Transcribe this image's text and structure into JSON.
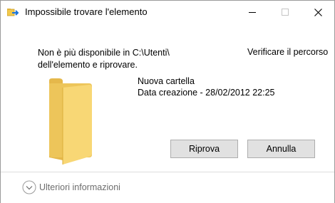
{
  "window": {
    "title": "Impossibile trovare l'elemento",
    "controls": {
      "minimize": "minimize-icon",
      "maximize": "maximize-icon",
      "close": "close-icon"
    }
  },
  "message": {
    "line1": "Non è più disponibile in C:\\Utenti\\",
    "line2": "dell'elemento e riprovare.",
    "verify_link": "Verificare il percorso"
  },
  "item": {
    "name": "Nuova cartella",
    "created": "Data creazione - 28/02/2012 22:25",
    "icon": "folder-icon"
  },
  "buttons": {
    "retry": "Riprova",
    "cancel": "Annulla"
  },
  "footer": {
    "more_info": "Ulteriori informazioni",
    "icon": "chevron-down-icon"
  },
  "colors": {
    "folder_front": "#f8d775",
    "folder_back": "#e5b84b",
    "button_bg": "#e1e1e1",
    "button_border": "#adadad",
    "footer_text": "#6d6d6d"
  }
}
